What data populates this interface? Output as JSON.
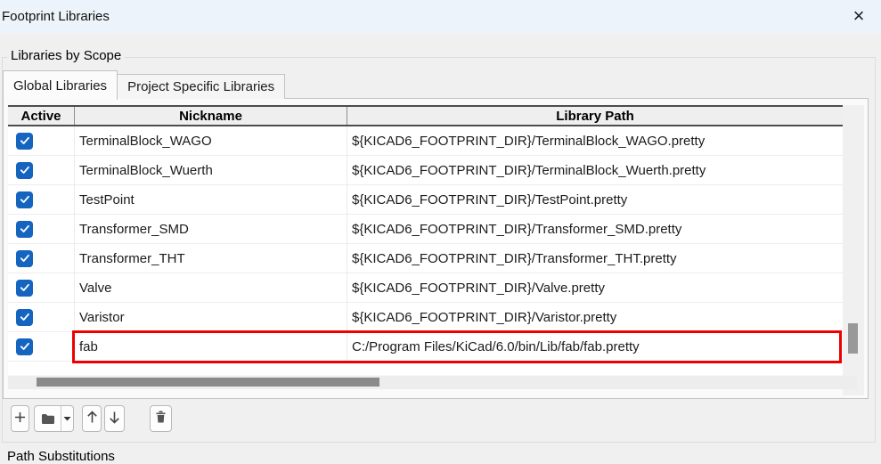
{
  "window": {
    "title": "Footprint Libraries"
  },
  "icons": {
    "close": "×",
    "browse_dropdown": "▾",
    "checked": "✓"
  },
  "scope_group": {
    "label": "Libraries by Scope"
  },
  "tabs": [
    {
      "label": "Global Libraries",
      "active": true
    },
    {
      "label": "Project Specific Libraries",
      "active": false
    }
  ],
  "table": {
    "columns": [
      "Active",
      "Nickname",
      "Library Path"
    ],
    "rows": [
      {
        "active": true,
        "nickname": "TerminalBlock_WAGO",
        "path": "${KICAD6_FOOTPRINT_DIR}/TerminalBlock_WAGO.pretty",
        "highlighted": false
      },
      {
        "active": true,
        "nickname": "TerminalBlock_Wuerth",
        "path": "${KICAD6_FOOTPRINT_DIR}/TerminalBlock_Wuerth.pretty",
        "highlighted": false
      },
      {
        "active": true,
        "nickname": "TestPoint",
        "path": "${KICAD6_FOOTPRINT_DIR}/TestPoint.pretty",
        "highlighted": false
      },
      {
        "active": true,
        "nickname": "Transformer_SMD",
        "path": "${KICAD6_FOOTPRINT_DIR}/Transformer_SMD.pretty",
        "highlighted": false
      },
      {
        "active": true,
        "nickname": "Transformer_THT",
        "path": "${KICAD6_FOOTPRINT_DIR}/Transformer_THT.pretty",
        "highlighted": false
      },
      {
        "active": true,
        "nickname": "Valve",
        "path": "${KICAD6_FOOTPRINT_DIR}/Valve.pretty",
        "highlighted": false
      },
      {
        "active": true,
        "nickname": "Varistor",
        "path": "${KICAD6_FOOTPRINT_DIR}/Varistor.pretty",
        "highlighted": false
      },
      {
        "active": true,
        "nickname": "fab",
        "path": "C:/Program Files/KiCad/6.0/bin/Lib/fab/fab.pretty",
        "highlighted": true
      }
    ]
  },
  "bottom_group": {
    "label": "Path Substitutions"
  },
  "colors": {
    "checkbox_blue": "#1565c0",
    "highlight_red": "#ee0000",
    "titlebar_bg": "#edf3fa",
    "dialog_bg": "#f0f0f0"
  }
}
